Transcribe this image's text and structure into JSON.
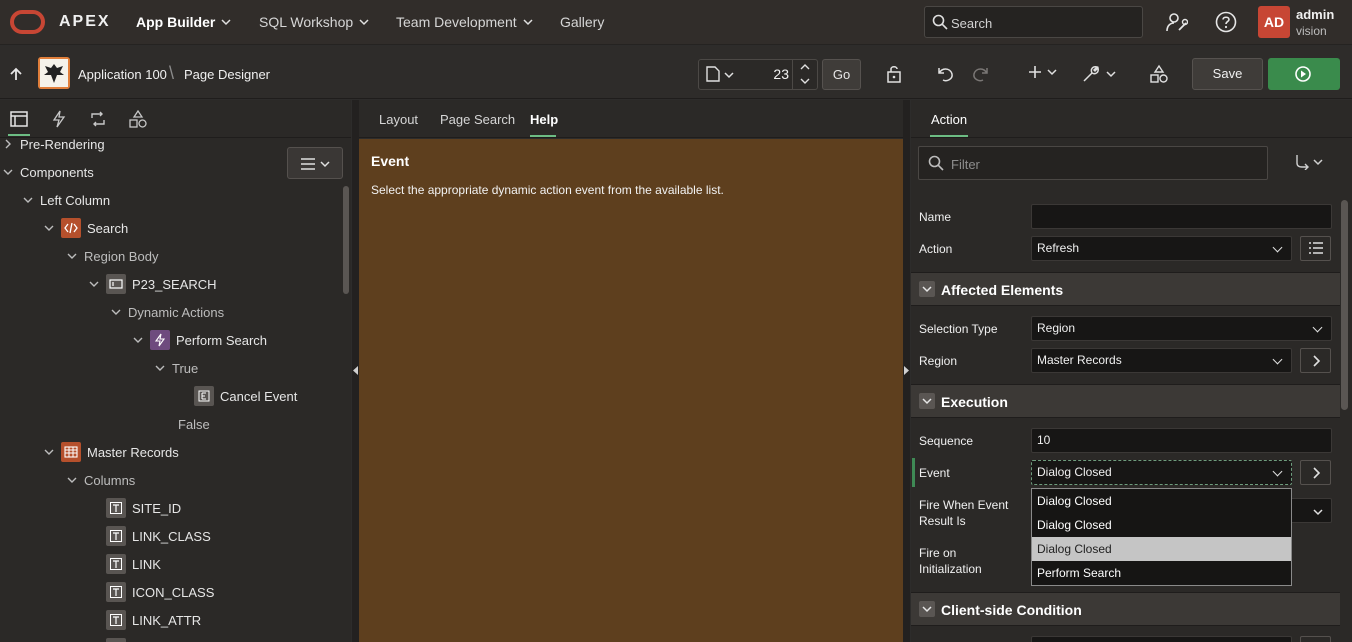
{
  "topbar": {
    "brand": "APEX",
    "nav": [
      "App Builder",
      "SQL Workshop",
      "Team Development",
      "Gallery"
    ],
    "search_placeholder": "Search",
    "user_initials": "AD",
    "user_name": "admin",
    "user_workspace": "vision"
  },
  "toolbar": {
    "breadcrumb": [
      "Application 100",
      "Page Designer"
    ],
    "page_number": "23",
    "go_label": "Go",
    "save_label": "Save"
  },
  "left_tree": {
    "items": [
      {
        "label": "Pre-Rendering",
        "level": 0
      },
      {
        "label": "Components",
        "level": 0
      },
      {
        "label": "Left Column",
        "level": 1
      },
      {
        "label": "Search",
        "level": 2
      },
      {
        "label": "Region Body",
        "level": 3
      },
      {
        "label": "P23_SEARCH",
        "level": 4
      },
      {
        "label": "Dynamic Actions",
        "level": 5
      },
      {
        "label": "Perform Search",
        "level": 6
      },
      {
        "label": "True",
        "level": 7
      },
      {
        "label": "Cancel Event",
        "level": 8
      },
      {
        "label": "False",
        "level": 7
      },
      {
        "label": "Master Records",
        "level": 2
      },
      {
        "label": "Columns",
        "level": 3
      },
      {
        "label": "SITE_ID",
        "level": 4
      },
      {
        "label": "LINK_CLASS",
        "level": 4
      },
      {
        "label": "LINK",
        "level": 4
      },
      {
        "label": "ICON_CLASS",
        "level": 4
      },
      {
        "label": "LINK_ATTR",
        "level": 4
      }
    ]
  },
  "middle": {
    "tabs": [
      "Layout",
      "Page Search",
      "Help"
    ],
    "help_title": "Event",
    "help_text": "Select the appropriate dynamic action event from the available list."
  },
  "right": {
    "tab": "Action",
    "filter_placeholder": "Filter",
    "name_label": "Name",
    "name_value": "",
    "action_label": "Action",
    "action_value": "Refresh",
    "sections": {
      "affected": "Affected Elements",
      "execution": "Execution",
      "client_condition": "Client-side Condition"
    },
    "selection_type_label": "Selection Type",
    "selection_type_value": "Region",
    "region_label": "Region",
    "region_value": "Master Records",
    "sequence_label": "Sequence",
    "sequence_value": "10",
    "event_label": "Event",
    "event_value": "Dialog Closed",
    "fire_when_label_1": "Fire When Event",
    "fire_when_label_2": "Result Is",
    "fire_init_label_1": "Fire on",
    "fire_init_label_2": "Initialization",
    "event_options": [
      "Dialog Closed",
      "Dialog Closed",
      "Dialog Closed",
      "Perform Search"
    ]
  },
  "colors": {
    "accent_green": "#3a8b4c",
    "brand_red": "#c74634",
    "help_bg": "#5e3f1e"
  }
}
